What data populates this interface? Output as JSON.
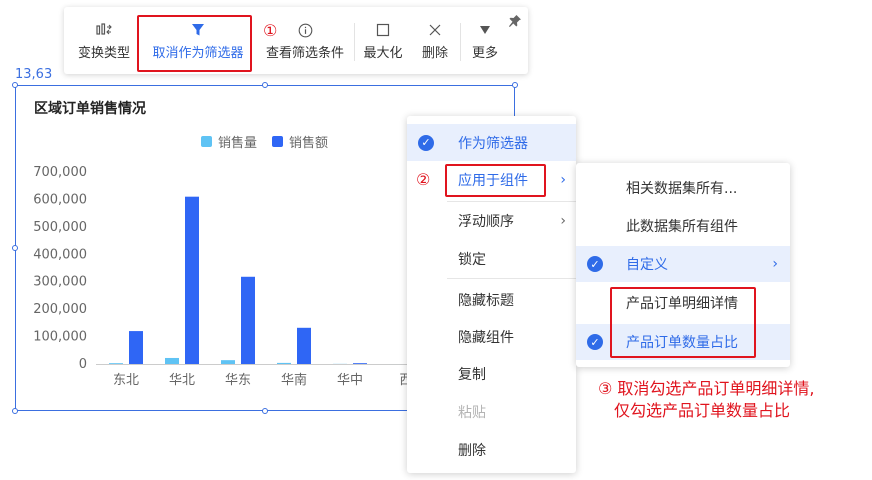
{
  "toolbar": {
    "items": [
      {
        "label": "变换类型",
        "icon": "chart-switch-icon"
      },
      {
        "label": "取消作为筛选器",
        "icon": "filter-icon"
      },
      {
        "label": "查看筛选条件",
        "icon": "info-icon"
      },
      {
        "label": "最大化",
        "icon": "maximize-icon"
      },
      {
        "label": "删除",
        "icon": "close-icon"
      },
      {
        "label": "更多",
        "icon": "more-icon"
      }
    ],
    "pin_icon": "pin-icon"
  },
  "annotations": {
    "step1": "①",
    "step2": "②",
    "step3_line1": "③ 取消勾选产品订单明细详情,",
    "step3_line2": "仅勾选产品订单数量占比"
  },
  "widget": {
    "position_label": "13,63"
  },
  "chart_data": {
    "type": "bar",
    "title": "区域订单销售情况",
    "categories": [
      "东北",
      "华北",
      "华东",
      "华南",
      "华中",
      "西北"
    ],
    "x_tick_labels_visible": [
      "东北",
      "华北",
      "华东",
      "华南",
      "华中",
      "西"
    ],
    "series": [
      {
        "name": "销售量",
        "color": "#5fc3f4",
        "values": [
          3000,
          22000,
          14000,
          4000,
          500,
          0
        ]
      },
      {
        "name": "销售额",
        "color": "#2f66f5",
        "values": [
          120000,
          610000,
          318000,
          132000,
          3000,
          0
        ]
      }
    ],
    "y_ticks": [
      "0",
      "100,000",
      "200,000",
      "300,000",
      "400,000",
      "500,000",
      "600,000",
      "700,000"
    ],
    "ylim": [
      0,
      700000
    ],
    "legend_position": "top",
    "grid": false
  },
  "context_menu": {
    "items": [
      {
        "label": "作为筛选器",
        "checked": true
      },
      {
        "label": "应用于组件",
        "submenu": true
      },
      {
        "label": "浮动顺序",
        "submenu": true
      },
      {
        "label": "锁定"
      },
      {
        "label": "隐藏标题"
      },
      {
        "label": "隐藏组件"
      },
      {
        "label": "复制"
      },
      {
        "label": "粘贴",
        "disabled": true
      },
      {
        "label": "删除"
      }
    ]
  },
  "submenu": {
    "items": [
      {
        "label": "相关数据集所有..."
      },
      {
        "label": "此数据集所有组件"
      },
      {
        "label": "自定义",
        "checked": true,
        "submenu": true
      },
      {
        "label": "产品订单明细详情"
      },
      {
        "label": "产品订单数量占比",
        "checked": true
      }
    ]
  },
  "colors": {
    "accent": "#2f6be8",
    "annotation_red": "#e0141e",
    "selection_bg": "#e8effd"
  }
}
